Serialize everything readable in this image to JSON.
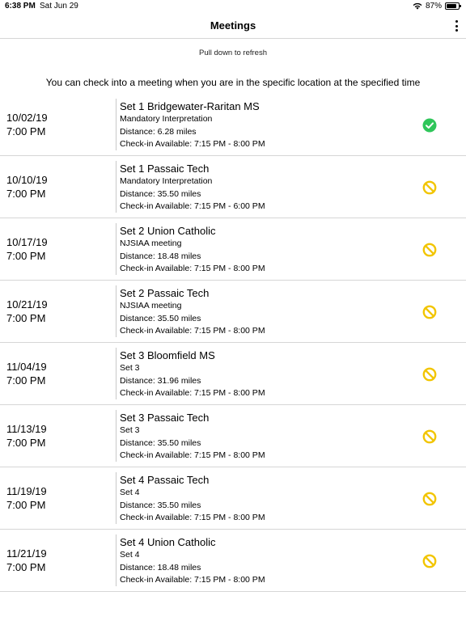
{
  "status_bar": {
    "time": "6:38 PM",
    "date": "Sat Jun 29",
    "battery": "87%",
    "battery_level": 0.87,
    "icons": [
      "wifi-icon",
      "battery-icon"
    ]
  },
  "nav": {
    "title": "Meetings",
    "menu_icon": "more-vertical-icon"
  },
  "refresh_hint": "Pull down to refresh",
  "info_text": "You can check into a meeting when you are in the specific location at the specified time",
  "colors": {
    "checked": "#2fc65a",
    "unavailable": "#f2c500",
    "divider": "#d6d6d6"
  },
  "meetings": [
    {
      "date": "10/02/19",
      "time": "7:00 PM",
      "name": "Set 1 Bridgewater-Raritan MS",
      "type": "Mandatory Interpretation",
      "distance": "Distance: 6.28 miles",
      "checkin": "Check-in Available: 7:15 PM - 8:00 PM",
      "status": "checked"
    },
    {
      "date": "10/10/19",
      "time": "7:00 PM",
      "name": "Set 1 Passaic Tech",
      "type": "Mandatory Interpretation",
      "distance": "Distance: 35.50 miles",
      "checkin": "Check-in Available: 7:15 PM - 6:00 PM",
      "status": "unavailable"
    },
    {
      "date": "10/17/19",
      "time": "7:00 PM",
      "name": "Set 2 Union Catholic",
      "type": "NJSIAA meeting",
      "distance": "Distance: 18.48 miles",
      "checkin": "Check-in Available: 7:15 PM - 8:00 PM",
      "status": "unavailable"
    },
    {
      "date": "10/21/19",
      "time": "7:00 PM",
      "name": "Set 2 Passaic Tech",
      "type": "NJSIAA meeting",
      "distance": "Distance: 35.50 miles",
      "checkin": "Check-in Available: 7:15 PM - 8:00 PM",
      "status": "unavailable"
    },
    {
      "date": "11/04/19",
      "time": "7:00 PM",
      "name": "Set 3 Bloomfield MS",
      "type": "Set 3",
      "distance": "Distance: 31.96 miles",
      "checkin": "Check-in Available: 7:15 PM - 8:00 PM",
      "status": "unavailable"
    },
    {
      "date": "11/13/19",
      "time": "7:00 PM",
      "name": "Set 3 Passaic Tech",
      "type": "Set 3",
      "distance": "Distance: 35.50 miles",
      "checkin": "Check-in Available: 7:15 PM - 8:00 PM",
      "status": "unavailable"
    },
    {
      "date": "11/19/19",
      "time": "7:00 PM",
      "name": "Set 4 Passaic Tech",
      "type": "Set 4",
      "distance": "Distance: 35.50 miles",
      "checkin": "Check-in Available: 7:15 PM - 8:00 PM",
      "status": "unavailable"
    },
    {
      "date": "11/21/19",
      "time": "7:00 PM",
      "name": "Set 4 Union Catholic",
      "type": "Set 4",
      "distance": "Distance: 18.48 miles",
      "checkin": "Check-in Available: 7:15 PM - 8:00 PM",
      "status": "unavailable"
    }
  ]
}
